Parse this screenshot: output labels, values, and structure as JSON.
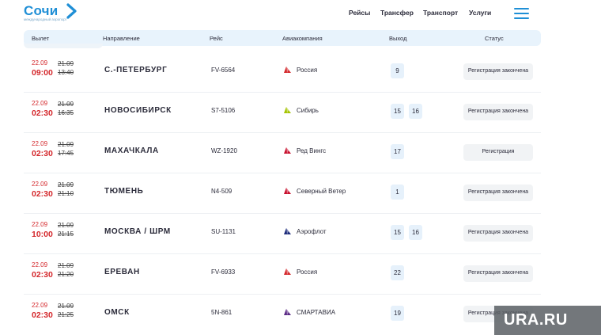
{
  "header": {
    "logo_text": "Сочи",
    "logo_subtitle": "международный аэропорт",
    "brand_color": "#1f8fd6",
    "nav": [
      "Рейсы",
      "Трансфер",
      "Транспорт",
      "Услуги"
    ],
    "menu_icon": "hamburger-menu-icon"
  },
  "table": {
    "columns": [
      "Вылет",
      "Направление",
      "Рейс",
      "Авиакомпания",
      "Выход",
      "Статус"
    ],
    "rows": [
      {
        "new_date": "22.09",
        "new_time": "09:00",
        "old_date": "21.09",
        "old_time": "13:40",
        "destination": "С.-ПЕТЕРБУРГ",
        "flight": "FV-6564",
        "airline": "Россия",
        "airline_color": "#d4282c",
        "gates": [
          "9"
        ],
        "status": "Регистрация закончена"
      },
      {
        "new_date": "22.09",
        "new_time": "02:30",
        "old_date": "21.09",
        "old_time": "16:35",
        "destination": "НОВОСИБИРСК",
        "flight": "S7-5106",
        "airline": "Сибирь",
        "airline_color": "#a5c400",
        "gates": [
          "15",
          "16"
        ],
        "status": "Регистрация закончена"
      },
      {
        "new_date": "22.09",
        "new_time": "02:30",
        "old_date": "21.09",
        "old_time": "17:45",
        "destination": "МАХАЧКАЛА",
        "flight": "WZ-1920",
        "airline": "Ред Вингс",
        "airline_color": "#c8102e",
        "gates": [
          "17"
        ],
        "status": "Регистрация"
      },
      {
        "new_date": "22.09",
        "new_time": "02:30",
        "old_date": "21.09",
        "old_time": "21:10",
        "destination": "ТЮМЕНЬ",
        "flight": "N4-509",
        "airline": "Северный Ветер",
        "airline_color": "#c8102e",
        "gates": [
          "1"
        ],
        "status": "Регистрация закончена"
      },
      {
        "new_date": "22.09",
        "new_time": "10:00",
        "old_date": "21.09",
        "old_time": "21:15",
        "destination": "МОСКВА / ШРМ",
        "flight": "SU-1131",
        "airline": "Аэрофлот",
        "airline_color": "#1c2a7a",
        "gates": [
          "15",
          "16"
        ],
        "status": "Регистрация закончена"
      },
      {
        "new_date": "22.09",
        "new_time": "02:30",
        "old_date": "21.09",
        "old_time": "21:20",
        "destination": "ЕРЕВАН",
        "flight": "FV-6933",
        "airline": "Россия",
        "airline_color": "#d4282c",
        "gates": [
          "22"
        ],
        "status": "Регистрация закончена"
      },
      {
        "new_date": "22.09",
        "new_time": "02:30",
        "old_date": "21.09",
        "old_time": "21:25",
        "destination": "ОМСК",
        "flight": "5N-861",
        "airline": "СМАРТАВИА",
        "airline_color": "#5b2a86",
        "gates": [
          "19"
        ],
        "status": "Регистрация закончена"
      }
    ]
  },
  "watermark": {
    "text": "URA.RU"
  }
}
